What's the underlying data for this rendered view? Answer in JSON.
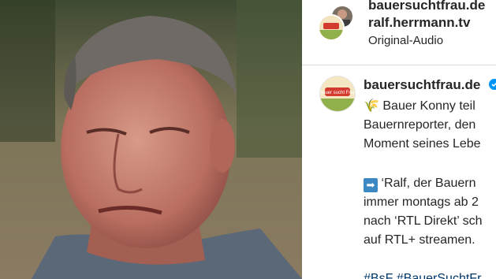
{
  "post_header": {
    "account": "bauersuchtfrau.de",
    "collab_account": "ralf.herrmann.tv",
    "audio_label": "Original-Audio"
  },
  "caption": {
    "author": "bauersuchtfrau.de",
    "leaf_emoji": "🌾",
    "line1": "Bauer Konny teil",
    "line2": "Bauernreporter, den",
    "line3": "Moment seines Lebe",
    "arrow_emoji": "➡",
    "line4": "‘Ralf, der Bauern",
    "line5": "immer montags ab 2",
    "line6": "nach ‘RTL Direkt’ sch",
    "line7": "auf RTL+ streamen.",
    "hashtags": "#BsF #BauerSuchtFr"
  },
  "logo_text": "Bauer sucht Frau",
  "colors": {
    "link": "#00376b",
    "text": "#262626",
    "divider": "#dbdbdb",
    "arrow_bg": "#3b88c3",
    "verified": "#0095f6"
  }
}
